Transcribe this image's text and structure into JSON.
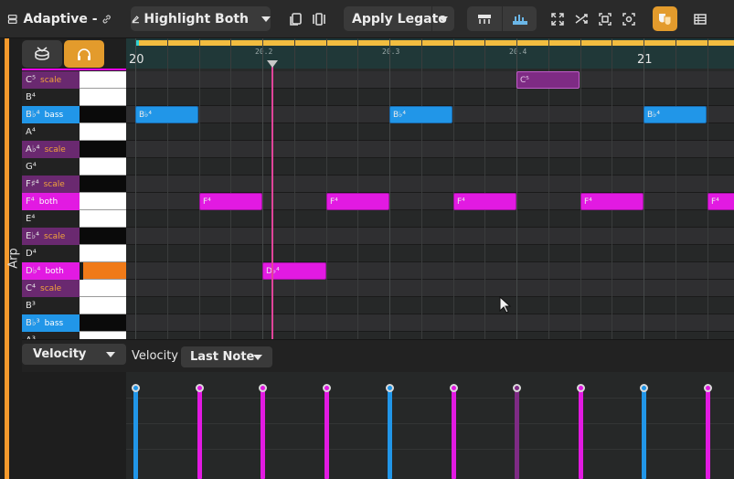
{
  "toolbar": {
    "title": "Adaptive -",
    "highlight_label": "Highlight Both",
    "apply_label": "Apply Legato",
    "accent_color": "#e39b2c"
  },
  "sidebar": {
    "label": "Arp"
  },
  "keyboard": {
    "rows": [
      {
        "name": "C⁵",
        "tag": "scale",
        "type": "scale",
        "key": "white"
      },
      {
        "name": "B⁴",
        "tag": "",
        "type": "none",
        "key": "white"
      },
      {
        "name": "B♭⁴",
        "tag": "bass",
        "type": "bass",
        "key": "black"
      },
      {
        "name": "A⁴",
        "tag": "",
        "type": "none",
        "key": "white"
      },
      {
        "name": "A♭⁴",
        "tag": "scale",
        "type": "scale",
        "key": "black"
      },
      {
        "name": "G⁴",
        "tag": "",
        "type": "none",
        "key": "white"
      },
      {
        "name": "F♯⁴",
        "tag": "scale",
        "type": "scale",
        "key": "black"
      },
      {
        "name": "F⁴",
        "tag": "both",
        "type": "both",
        "key": "white"
      },
      {
        "name": "E⁴",
        "tag": "",
        "type": "none",
        "key": "white"
      },
      {
        "name": "E♭⁴",
        "tag": "scale",
        "type": "scale",
        "key": "black"
      },
      {
        "name": "D⁴",
        "tag": "",
        "type": "none",
        "key": "white"
      },
      {
        "name": "D♭⁴",
        "tag": "both",
        "type": "both",
        "key": "orange"
      },
      {
        "name": "C⁴",
        "tag": "scale",
        "type": "scale",
        "key": "white"
      },
      {
        "name": "B³",
        "tag": "",
        "type": "none",
        "key": "white"
      },
      {
        "name": "B♭³",
        "tag": "bass",
        "type": "bass",
        "key": "black"
      },
      {
        "name": "A³",
        "tag": "",
        "type": "none",
        "key": "white"
      }
    ]
  },
  "ruler": {
    "labels": [
      "20",
      "20.2",
      "20.3",
      "20.4",
      "21"
    ]
  },
  "notes": [
    {
      "label": "C⁵",
      "type": "scale",
      "row": 0
    },
    {
      "label": "B♭⁴",
      "type": "bass",
      "row": 2
    },
    {
      "label": "B♭⁴",
      "type": "bass",
      "row": 2
    },
    {
      "label": "B♭⁴",
      "type": "bass",
      "row": 2
    },
    {
      "label": "F⁴",
      "type": "both",
      "row": 7
    },
    {
      "label": "F⁴",
      "type": "both",
      "row": 7
    },
    {
      "label": "F⁴",
      "type": "both",
      "row": 7
    },
    {
      "label": "F⁴",
      "type": "both",
      "row": 7
    },
    {
      "label": "F⁴",
      "type": "both",
      "row": 7
    },
    {
      "label": "D♭⁴",
      "type": "both",
      "row": 11
    }
  ],
  "velocity": {
    "lane_label": "Velocity",
    "header_label": "Velocity",
    "mode_label": "Last Note",
    "bars": [
      {
        "color": "#2196e8",
        "value": 1.0
      },
      {
        "color": "#e21ae2",
        "value": 1.0
      },
      {
        "color": "#e21ae2",
        "value": 1.0
      },
      {
        "color": "#e21ae2",
        "value": 1.0
      },
      {
        "color": "#2196e8",
        "value": 1.0
      },
      {
        "color": "#e21ae2",
        "value": 1.0
      },
      {
        "color": "#7e2b84",
        "value": 1.0
      },
      {
        "color": "#e21ae2",
        "value": 1.0
      },
      {
        "color": "#2196e8",
        "value": 1.0
      },
      {
        "color": "#e21ae2",
        "value": 1.0
      }
    ]
  }
}
